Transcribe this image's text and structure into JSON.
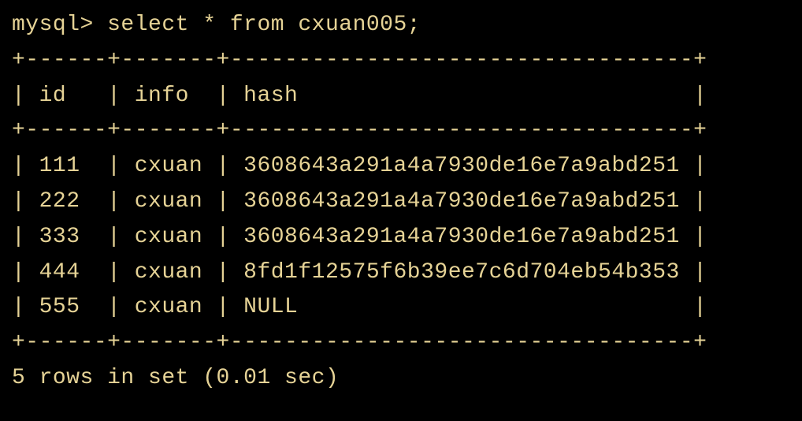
{
  "prompt": "mysql> ",
  "query": "select * from cxuan005;",
  "border_top": "+------+-------+----------------------------------+",
  "header_row": "| id   | info  | hash                             |",
  "border_mid": "+------+-------+----------------------------------+",
  "rows": [
    "| 111  | cxuan | 3608643a291a4a7930de16e7a9abd251 |",
    "| 222  | cxuan | 3608643a291a4a7930de16e7a9abd251 |",
    "| 333  | cxuan | 3608643a291a4a7930de16e7a9abd251 |",
    "| 444  | cxuan | 8fd1f12575f6b39ee7c6d704eb54b353 |",
    "| 555  | cxuan | NULL                             |"
  ],
  "border_bot": "+------+-------+----------------------------------+",
  "footer": "5 rows in set (0.01 sec)",
  "table_data": {
    "columns": [
      "id",
      "info",
      "hash"
    ],
    "data": [
      {
        "id": "111",
        "info": "cxuan",
        "hash": "3608643a291a4a7930de16e7a9abd251"
      },
      {
        "id": "222",
        "info": "cxuan",
        "hash": "3608643a291a4a7930de16e7a9abd251"
      },
      {
        "id": "333",
        "info": "cxuan",
        "hash": "3608643a291a4a7930de16e7a9abd251"
      },
      {
        "id": "444",
        "info": "cxuan",
        "hash": "8fd1f12575f6b39ee7c6d704eb54b353"
      },
      {
        "id": "555",
        "info": "cxuan",
        "hash": "NULL"
      }
    ]
  }
}
